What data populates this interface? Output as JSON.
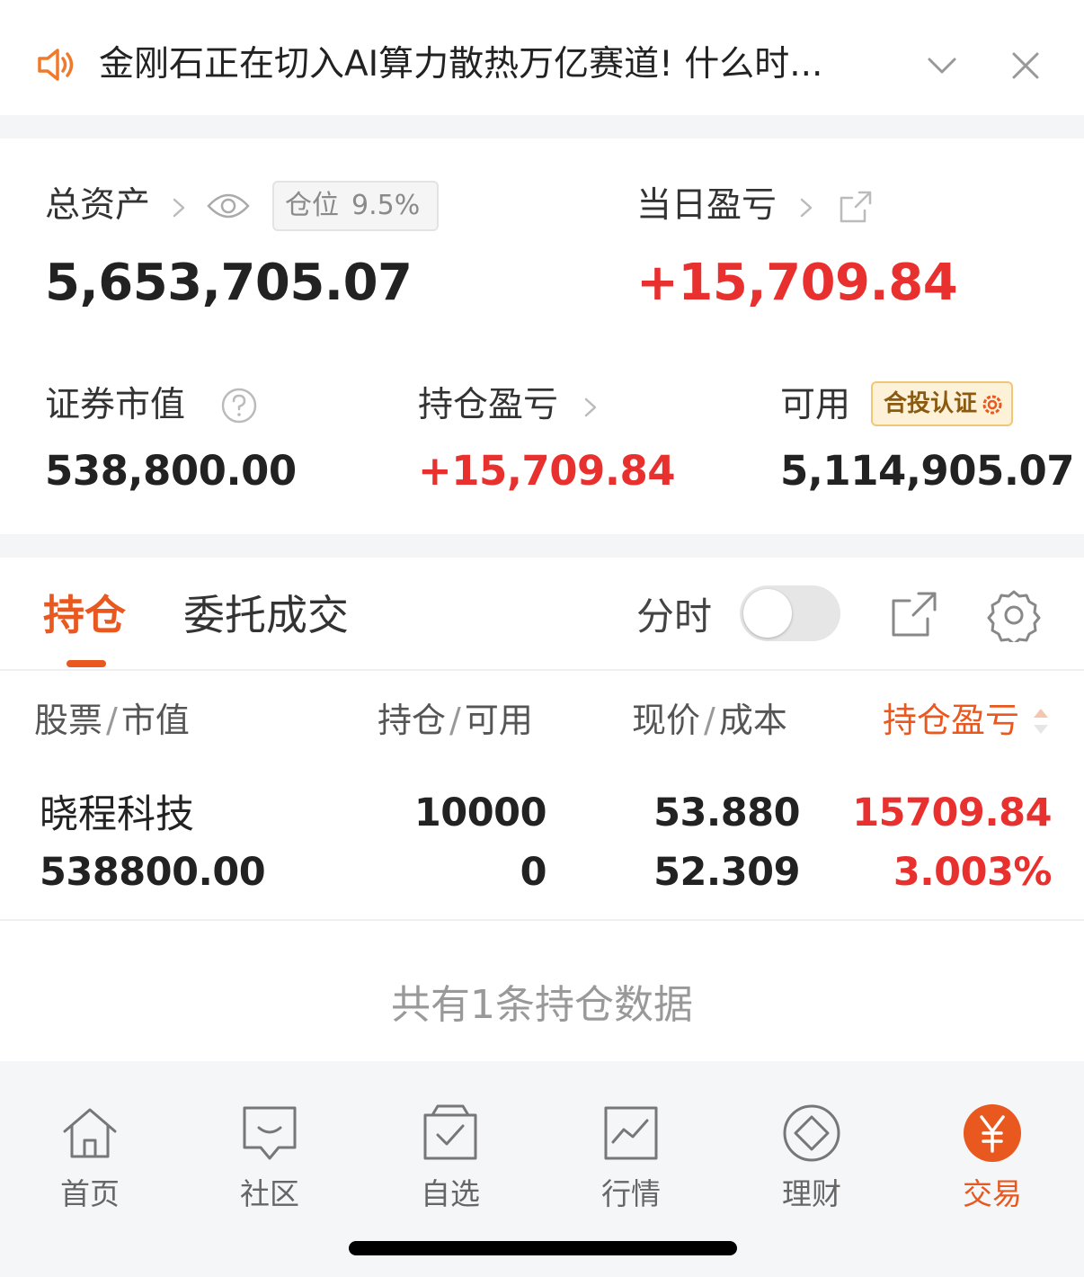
{
  "notice": {
    "text": "金刚石正在切入AI算力散热万亿赛道! 什么时..."
  },
  "assets": {
    "total_label": "总资产",
    "position_label": "仓位",
    "position_value": "9.5%",
    "total_value": "5,653,705.07",
    "daily_pl_label": "当日盈亏",
    "daily_pl_value": "+15,709.84",
    "securities_label": "证券市值",
    "securities_value": "538,800.00",
    "holding_pl_label": "持仓盈亏",
    "holding_pl_value": "+15,709.84",
    "available_label": "可用",
    "cert_label": "合投认证",
    "available_value": "5,114,905.07"
  },
  "tabs": {
    "holdings": "持仓",
    "orders": "委托成交",
    "timeshare": "分时"
  },
  "table": {
    "headers": {
      "stock": "股票",
      "market_value": "市值",
      "position": "持仓",
      "available": "可用",
      "price": "现价",
      "cost": "成本",
      "pl": "持仓盈亏",
      "sep": "/"
    },
    "rows": [
      {
        "name": "晓程科技",
        "market_value": "538800.00",
        "position": "10000",
        "available": "0",
        "price": "53.880",
        "cost": "52.309",
        "pl": "15709.84",
        "pl_pct": "3.003%"
      }
    ],
    "summary": "共有1条持仓数据"
  },
  "nav": {
    "items": [
      {
        "label": "首页",
        "icon": "home-icon"
      },
      {
        "label": "社区",
        "icon": "chat-icon"
      },
      {
        "label": "自选",
        "icon": "watchlist-icon"
      },
      {
        "label": "行情",
        "icon": "chart-icon"
      },
      {
        "label": "理财",
        "icon": "diamond-icon"
      },
      {
        "label": "交易",
        "icon": "yen-icon"
      }
    ],
    "active_index": 5
  },
  "colors": {
    "accent": "#e8581f",
    "gain": "#e8312f"
  }
}
